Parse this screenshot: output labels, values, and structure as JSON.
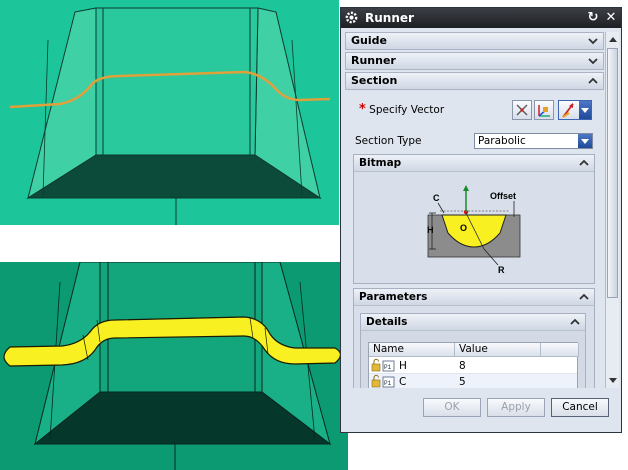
{
  "dialog": {
    "title": "Runner",
    "groups": {
      "guide": "Guide",
      "runner": "Runner",
      "section": "Section"
    },
    "specify_vector": "Specify Vector",
    "section_type_label": "Section Type",
    "section_type_value": "Parabolic",
    "bitmap": {
      "header": "Bitmap",
      "labels": {
        "c": "C",
        "h": "H",
        "offset": "Offset",
        "o": "O",
        "r": "R"
      }
    },
    "parameters": {
      "header": "Parameters",
      "details_header": "Details",
      "columns": [
        "Name",
        "Value"
      ],
      "rows": [
        {
          "name": "H",
          "value": "8"
        },
        {
          "name": "C",
          "value": "5"
        }
      ]
    },
    "buttons": {
      "ok": "OK",
      "apply": "Apply",
      "cancel": "Cancel"
    }
  },
  "colors": {
    "viewport_top_bg": "#1cc59a",
    "viewport_bottom_bg": "#0b9a72",
    "runner_path": "#e0a03a",
    "runner_solid": "#f8f020",
    "dialog_bg": "#dfe5ef"
  },
  "icons": {
    "gear": "gear-icon",
    "reset": "reset-icon",
    "close": "close-icon",
    "chevron_down": "chevron-down-icon",
    "chevron_up": "chevron-up-icon"
  }
}
